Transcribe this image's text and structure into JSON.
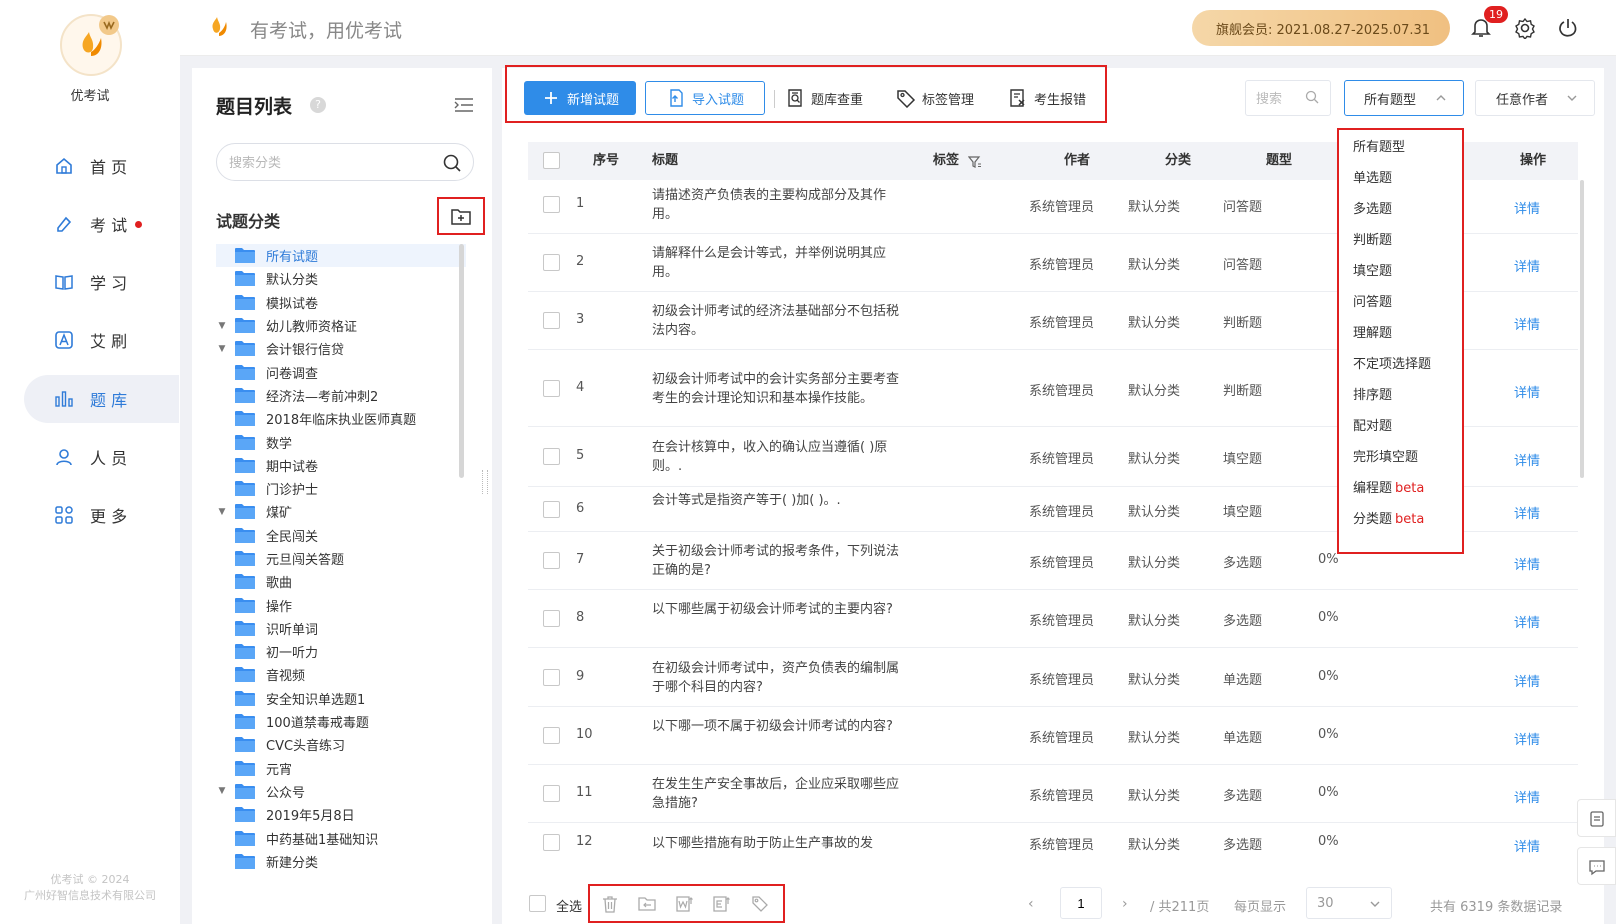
{
  "app": {
    "name": "优考试",
    "slogan": "有考试，用优考试",
    "copyright_line1": "优考试 © 2024",
    "copyright_line2": "广州好智信息技术有限公司"
  },
  "nav": [
    {
      "label": "首 页",
      "icon": "home-icon"
    },
    {
      "label": "考 试",
      "icon": "exam-icon",
      "dot": true
    },
    {
      "label": "学 习",
      "icon": "book-icon"
    },
    {
      "label": "艾 刷",
      "icon": "a-badge-icon"
    },
    {
      "label": "题 库",
      "icon": "bar-chart-icon",
      "active": true
    },
    {
      "label": "人 员",
      "icon": "user-icon"
    },
    {
      "label": "更 多",
      "icon": "apps-icon"
    }
  ],
  "header": {
    "vip_text": "旗舰会员: 2021.08.27-2025.07.31",
    "notification_count": "19"
  },
  "category_panel": {
    "title": "题目列表",
    "help": "?",
    "search_placeholder": "搜索分类",
    "heading": "试题分类",
    "items": [
      {
        "label": "所有试题",
        "selected": true,
        "arrow": ""
      },
      {
        "label": "默认分类",
        "arrow": ""
      },
      {
        "label": "模拟试卷",
        "arrow": ""
      },
      {
        "label": "幼儿教师资格证",
        "arrow": "▼"
      },
      {
        "label": "会计银行信贷",
        "arrow": "▼"
      },
      {
        "label": "问卷调查",
        "arrow": ""
      },
      {
        "label": "经济法—考前冲刺2",
        "arrow": ""
      },
      {
        "label": "2018年临床执业医师真题",
        "arrow": ""
      },
      {
        "label": "数学",
        "arrow": ""
      },
      {
        "label": "期中试卷",
        "arrow": ""
      },
      {
        "label": "门诊护士",
        "arrow": ""
      },
      {
        "label": "煤矿",
        "arrow": "▼"
      },
      {
        "label": "全民闯关",
        "arrow": ""
      },
      {
        "label": "元旦闯关答题",
        "arrow": ""
      },
      {
        "label": "歌曲",
        "arrow": ""
      },
      {
        "label": "操作",
        "arrow": ""
      },
      {
        "label": "识听单词",
        "arrow": ""
      },
      {
        "label": "初一听力",
        "arrow": ""
      },
      {
        "label": "音视频",
        "arrow": ""
      },
      {
        "label": "安全知识单选题1",
        "arrow": ""
      },
      {
        "label": "100道禁毒戒毒题",
        "arrow": ""
      },
      {
        "label": "CVC头音练习",
        "arrow": ""
      },
      {
        "label": "元宵",
        "arrow": ""
      },
      {
        "label": "公众号",
        "arrow": "▼"
      },
      {
        "label": "2019年5月8日",
        "arrow": ""
      },
      {
        "label": "中药基础1基础知识",
        "arrow": ""
      },
      {
        "label": "新建分类",
        "arrow": ""
      }
    ]
  },
  "toolbar": {
    "new_label": "新增试题",
    "import_label": "导入试题",
    "dup_label": "题库查重",
    "tag_label": "标签管理",
    "report_label": "考生报错",
    "search_placeholder": "搜索",
    "type_select": "所有题型",
    "author_select": "任意作者"
  },
  "table": {
    "headers": {
      "index": "序号",
      "title": "标题",
      "tags": "标签",
      "author": "作者",
      "category": "分类",
      "type": "题型",
      "action": "操作"
    },
    "rows": [
      {
        "index": "1",
        "title": "请描述资产负债表的主要构成部分及其作用。",
        "author": "系统管理员",
        "category": "默认分类",
        "type": "问答题",
        "rate": "",
        "action": "详情"
      },
      {
        "index": "2",
        "title": "请解释什么是会计等式，并举例说明其应用。",
        "author": "系统管理员",
        "category": "默认分类",
        "type": "问答题",
        "rate": "",
        "action": "详情"
      },
      {
        "index": "3",
        "title": "初级会计师考试的经济法基础部分不包括税法内容。",
        "author": "系统管理员",
        "category": "默认分类",
        "type": "判断题",
        "rate": "",
        "action": "详情"
      },
      {
        "index": "4",
        "title": "初级会计师考试中的会计实务部分主要考查考生的会计理论知识和基本操作技能。",
        "author": "系统管理员",
        "category": "默认分类",
        "type": "判断题",
        "rate": "",
        "action": "详情"
      },
      {
        "index": "5",
        "title": "在会计核算中，收入的确认应当遵循(   )原则。.",
        "author": "系统管理员",
        "category": "默认分类",
        "type": "填空题",
        "rate": "",
        "action": "详情"
      },
      {
        "index": "6",
        "title": "会计等式是指资产等于(   )加(   )。.",
        "author": "系统管理员",
        "category": "默认分类",
        "type": "填空题",
        "rate": "",
        "action": "详情"
      },
      {
        "index": "7",
        "title": "关于初级会计师考试的报考条件，下列说法正确的是?",
        "author": "系统管理员",
        "category": "默认分类",
        "type": "多选题",
        "rate": "0%",
        "action": "详情"
      },
      {
        "index": "8",
        "title": "以下哪些属于初级会计师考试的主要内容?",
        "author": "系统管理员",
        "category": "默认分类",
        "type": "多选题",
        "rate": "0%",
        "action": "详情"
      },
      {
        "index": "9",
        "title": "在初级会计师考试中，资产负债表的编制属于哪个科目的内容?",
        "author": "系统管理员",
        "category": "默认分类",
        "type": "单选题",
        "rate": "0%",
        "action": "详情"
      },
      {
        "index": "10",
        "title": "以下哪一项不属于初级会计师考试的内容?",
        "author": "系统管理员",
        "category": "默认分类",
        "type": "单选题",
        "rate": "0%",
        "action": "详情"
      },
      {
        "index": "11",
        "title": "在发生生产安全事故后，企业应采取哪些应急措施?",
        "author": "系统管理员",
        "category": "默认分类",
        "type": "多选题",
        "rate": "0%",
        "action": "详情"
      },
      {
        "index": "12",
        "title": "以下哪些措施有助于防止生产事故的发",
        "author": "系统管理员",
        "category": "默认分类",
        "type": "多选题",
        "rate": "0%",
        "action": "详情"
      }
    ]
  },
  "type_dropdown": [
    {
      "label": "所有题型",
      "beta": ""
    },
    {
      "label": "单选题",
      "beta": ""
    },
    {
      "label": "多选题",
      "beta": ""
    },
    {
      "label": "判断题",
      "beta": ""
    },
    {
      "label": "填空题",
      "beta": ""
    },
    {
      "label": "问答题",
      "beta": ""
    },
    {
      "label": "理解题",
      "beta": ""
    },
    {
      "label": "不定项选择题",
      "beta": ""
    },
    {
      "label": "排序题",
      "beta": ""
    },
    {
      "label": "配对题",
      "beta": ""
    },
    {
      "label": "完形填空题",
      "beta": ""
    },
    {
      "label": "编程题",
      "beta": "beta"
    },
    {
      "label": "分类题",
      "beta": "beta"
    }
  ],
  "footer": {
    "select_all": "全选",
    "page_value": "1",
    "total_pages": "/ 共211页",
    "page_size_label": "每页显示",
    "page_size": "30",
    "record_count": "共有 6319 条数据记录"
  }
}
